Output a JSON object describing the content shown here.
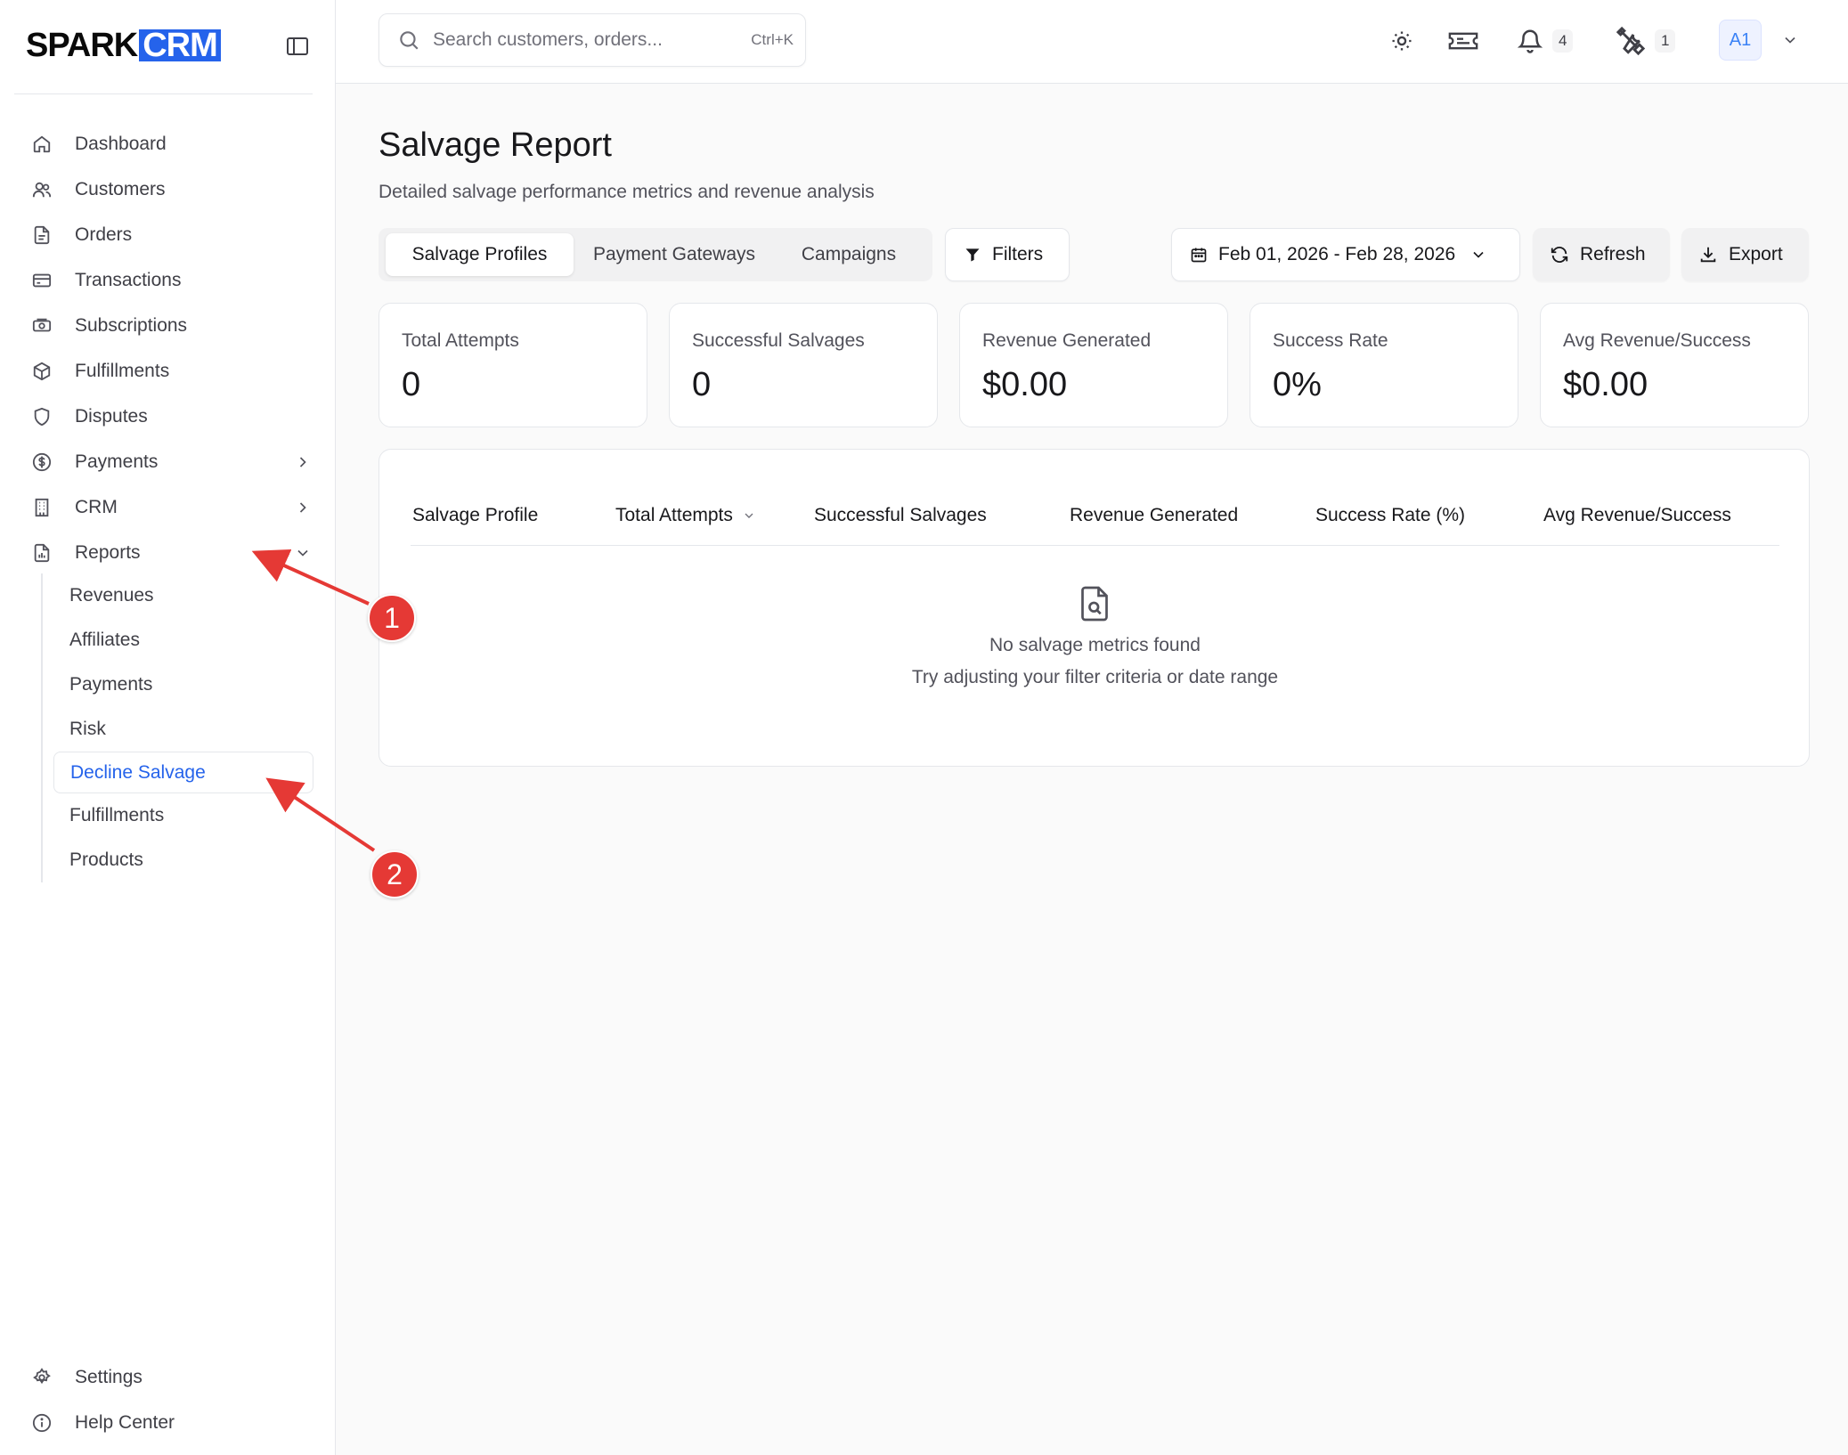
{
  "brand": {
    "part1": "SPARK",
    "part2": "CRM"
  },
  "search": {
    "placeholder": "Search customers, orders...",
    "shortcut": "Ctrl+K"
  },
  "header": {
    "notifications_count": "4",
    "tools_count": "1",
    "avatar": "A1"
  },
  "sidebar": {
    "items": [
      {
        "label": "Dashboard",
        "icon": "home-icon"
      },
      {
        "label": "Customers",
        "icon": "users-icon"
      },
      {
        "label": "Orders",
        "icon": "file-icon"
      },
      {
        "label": "Transactions",
        "icon": "credit-card-icon"
      },
      {
        "label": "Subscriptions",
        "icon": "banknote-icon"
      },
      {
        "label": "Fulfillments",
        "icon": "package-icon"
      },
      {
        "label": "Disputes",
        "icon": "shield-icon"
      },
      {
        "label": "Payments",
        "icon": "dollar-circle-icon"
      },
      {
        "label": "CRM",
        "icon": "building-icon"
      },
      {
        "label": "Reports",
        "icon": "report-icon"
      }
    ],
    "reports_sub": [
      "Revenues",
      "Affiliates",
      "Payments",
      "Risk",
      "Decline Salvage",
      "Fulfillments",
      "Products"
    ],
    "bottom": [
      {
        "label": "Settings",
        "icon": "gear-icon"
      },
      {
        "label": "Help Center",
        "icon": "info-icon"
      }
    ]
  },
  "page": {
    "title": "Salvage Report",
    "subtitle": "Detailed salvage performance metrics and revenue analysis",
    "tabs": [
      "Salvage Profiles",
      "Payment Gateways",
      "Campaigns"
    ],
    "filters_label": "Filters",
    "date_range": "Feb 01, 2026 - Feb 28, 2026",
    "refresh_label": "Refresh",
    "export_label": "Export"
  },
  "stats": [
    {
      "label": "Total Attempts",
      "value": "0"
    },
    {
      "label": "Successful Salvages",
      "value": "0"
    },
    {
      "label": "Revenue Generated",
      "value": "$0.00"
    },
    {
      "label": "Success Rate",
      "value": "0%"
    },
    {
      "label": "Avg Revenue/Success",
      "value": "$0.00"
    }
  ],
  "table": {
    "columns": [
      "Salvage Profile",
      "Total Attempts",
      "Successful Salvages",
      "Revenue Generated",
      "Success Rate (%)",
      "Avg Revenue/Success"
    ],
    "empty_title": "No salvage metrics found",
    "empty_subtitle": "Try adjusting your filter criteria or date range"
  },
  "annotations": [
    "1",
    "2"
  ],
  "colors": {
    "accent": "#2563eb",
    "marker": "#e53935"
  }
}
